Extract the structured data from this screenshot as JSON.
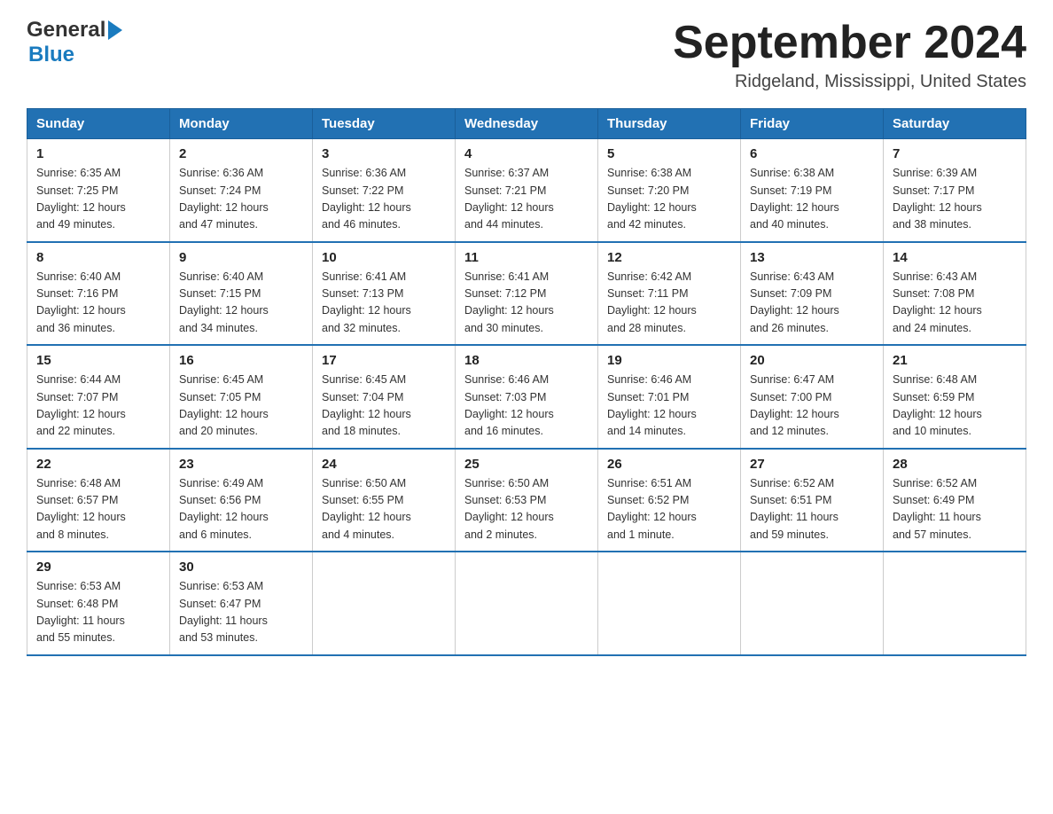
{
  "header": {
    "logo_general": "General",
    "logo_blue": "Blue",
    "month_title": "September 2024",
    "location": "Ridgeland, Mississippi, United States"
  },
  "days_of_week": [
    "Sunday",
    "Monday",
    "Tuesday",
    "Wednesday",
    "Thursday",
    "Friday",
    "Saturday"
  ],
  "weeks": [
    [
      {
        "day": "1",
        "sunrise": "6:35 AM",
        "sunset": "7:25 PM",
        "daylight": "12 hours and 49 minutes."
      },
      {
        "day": "2",
        "sunrise": "6:36 AM",
        "sunset": "7:24 PM",
        "daylight": "12 hours and 47 minutes."
      },
      {
        "day": "3",
        "sunrise": "6:36 AM",
        "sunset": "7:22 PM",
        "daylight": "12 hours and 46 minutes."
      },
      {
        "day": "4",
        "sunrise": "6:37 AM",
        "sunset": "7:21 PM",
        "daylight": "12 hours and 44 minutes."
      },
      {
        "day": "5",
        "sunrise": "6:38 AM",
        "sunset": "7:20 PM",
        "daylight": "12 hours and 42 minutes."
      },
      {
        "day": "6",
        "sunrise": "6:38 AM",
        "sunset": "7:19 PM",
        "daylight": "12 hours and 40 minutes."
      },
      {
        "day": "7",
        "sunrise": "6:39 AM",
        "sunset": "7:17 PM",
        "daylight": "12 hours and 38 minutes."
      }
    ],
    [
      {
        "day": "8",
        "sunrise": "6:40 AM",
        "sunset": "7:16 PM",
        "daylight": "12 hours and 36 minutes."
      },
      {
        "day": "9",
        "sunrise": "6:40 AM",
        "sunset": "7:15 PM",
        "daylight": "12 hours and 34 minutes."
      },
      {
        "day": "10",
        "sunrise": "6:41 AM",
        "sunset": "7:13 PM",
        "daylight": "12 hours and 32 minutes."
      },
      {
        "day": "11",
        "sunrise": "6:41 AM",
        "sunset": "7:12 PM",
        "daylight": "12 hours and 30 minutes."
      },
      {
        "day": "12",
        "sunrise": "6:42 AM",
        "sunset": "7:11 PM",
        "daylight": "12 hours and 28 minutes."
      },
      {
        "day": "13",
        "sunrise": "6:43 AM",
        "sunset": "7:09 PM",
        "daylight": "12 hours and 26 minutes."
      },
      {
        "day": "14",
        "sunrise": "6:43 AM",
        "sunset": "7:08 PM",
        "daylight": "12 hours and 24 minutes."
      }
    ],
    [
      {
        "day": "15",
        "sunrise": "6:44 AM",
        "sunset": "7:07 PM",
        "daylight": "12 hours and 22 minutes."
      },
      {
        "day": "16",
        "sunrise": "6:45 AM",
        "sunset": "7:05 PM",
        "daylight": "12 hours and 20 minutes."
      },
      {
        "day": "17",
        "sunrise": "6:45 AM",
        "sunset": "7:04 PM",
        "daylight": "12 hours and 18 minutes."
      },
      {
        "day": "18",
        "sunrise": "6:46 AM",
        "sunset": "7:03 PM",
        "daylight": "12 hours and 16 minutes."
      },
      {
        "day": "19",
        "sunrise": "6:46 AM",
        "sunset": "7:01 PM",
        "daylight": "12 hours and 14 minutes."
      },
      {
        "day": "20",
        "sunrise": "6:47 AM",
        "sunset": "7:00 PM",
        "daylight": "12 hours and 12 minutes."
      },
      {
        "day": "21",
        "sunrise": "6:48 AM",
        "sunset": "6:59 PM",
        "daylight": "12 hours and 10 minutes."
      }
    ],
    [
      {
        "day": "22",
        "sunrise": "6:48 AM",
        "sunset": "6:57 PM",
        "daylight": "12 hours and 8 minutes."
      },
      {
        "day": "23",
        "sunrise": "6:49 AM",
        "sunset": "6:56 PM",
        "daylight": "12 hours and 6 minutes."
      },
      {
        "day": "24",
        "sunrise": "6:50 AM",
        "sunset": "6:55 PM",
        "daylight": "12 hours and 4 minutes."
      },
      {
        "day": "25",
        "sunrise": "6:50 AM",
        "sunset": "6:53 PM",
        "daylight": "12 hours and 2 minutes."
      },
      {
        "day": "26",
        "sunrise": "6:51 AM",
        "sunset": "6:52 PM",
        "daylight": "12 hours and 1 minute."
      },
      {
        "day": "27",
        "sunrise": "6:52 AM",
        "sunset": "6:51 PM",
        "daylight": "11 hours and 59 minutes."
      },
      {
        "day": "28",
        "sunrise": "6:52 AM",
        "sunset": "6:49 PM",
        "daylight": "11 hours and 57 minutes."
      }
    ],
    [
      {
        "day": "29",
        "sunrise": "6:53 AM",
        "sunset": "6:48 PM",
        "daylight": "11 hours and 55 minutes."
      },
      {
        "day": "30",
        "sunrise": "6:53 AM",
        "sunset": "6:47 PM",
        "daylight": "11 hours and 53 minutes."
      },
      null,
      null,
      null,
      null,
      null
    ]
  ],
  "labels": {
    "sunrise": "Sunrise:",
    "sunset": "Sunset:",
    "daylight": "Daylight:"
  }
}
